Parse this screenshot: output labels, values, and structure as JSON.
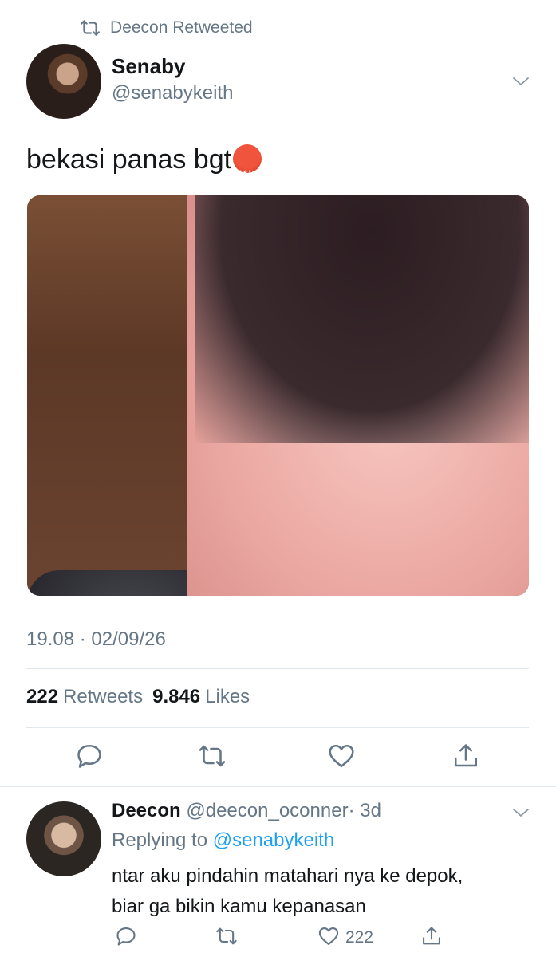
{
  "retweet_context": {
    "label": "Deecon Retweeted",
    "icon": "retweet-icon"
  },
  "tweet": {
    "author_name": "Senaby",
    "author_handle": "@senabykeith",
    "text": "bekasi panas bgt",
    "emoji": "face-with-symbols-on-mouth",
    "emoji_symbols": "&$!#%",
    "timestamp": "19.08 · 02/09/26",
    "retweets_count": "222",
    "retweets_label": "Retweets",
    "likes_count": "9.846",
    "likes_label": "Likes"
  },
  "actions": [
    "reply-icon",
    "retweet-icon",
    "heart-icon",
    "share-icon"
  ],
  "reply": {
    "author_name": "Deecon",
    "author_handle": "@deecon_oconner",
    "time": "· 3d",
    "replying_prefix": "Replying to",
    "replying_handle": "@senabykeith",
    "text_line1": "ntar aku pindahin matahari nya ke depok,",
    "text_line2": "biar ga bikin kamu kepanasan",
    "like_count": "222"
  },
  "colors": {
    "accent": "#1da1f2",
    "secondary_text": "#657786",
    "primary_text": "#14171a",
    "divider": "#e1e8ed"
  }
}
